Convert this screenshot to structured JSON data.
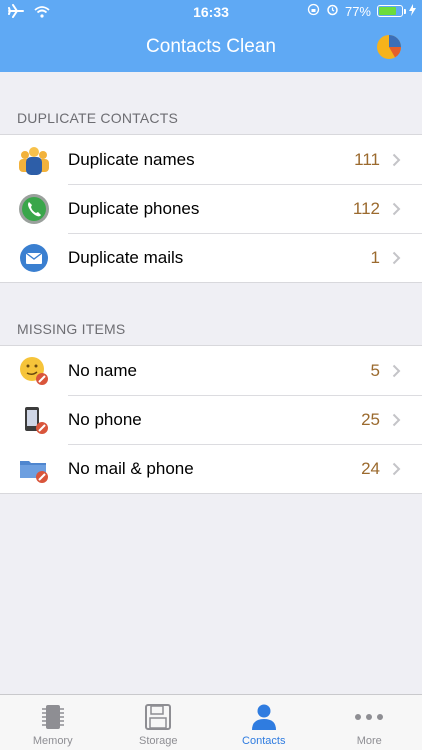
{
  "status": {
    "time": "16:33",
    "battery": "77%",
    "battery_level": 0.77
  },
  "nav": {
    "title": "Contacts Clean",
    "action_icon": "pie-chart-icon"
  },
  "sections": [
    {
      "header": "DUPLICATE CONTACTS",
      "rows": [
        {
          "label": "Duplicate names",
          "count": "111",
          "icon": "group-people-icon"
        },
        {
          "label": "Duplicate phones",
          "count": "112",
          "icon": "phone-icon"
        },
        {
          "label": "Duplicate mails",
          "count": "1",
          "icon": "mail-icon"
        }
      ]
    },
    {
      "header": "MISSING ITEMS",
      "rows": [
        {
          "label": "No name",
          "count": "5",
          "icon": "no-name-face-icon"
        },
        {
          "label": "No phone",
          "count": "25",
          "icon": "no-phone-icon"
        },
        {
          "label": "No mail & phone",
          "count": "24",
          "icon": "no-mail-folder-icon"
        }
      ]
    }
  ],
  "tabs": [
    {
      "label": "Memory",
      "icon": "chip-icon",
      "active": false
    },
    {
      "label": "Storage",
      "icon": "floppy-icon",
      "active": false
    },
    {
      "label": "Contacts",
      "icon": "person-icon",
      "active": true
    },
    {
      "label": "More",
      "icon": "more-dots-icon",
      "active": false
    }
  ],
  "colors": {
    "nav_bg": "#5fa9f4",
    "count_text": "#9b6a2e",
    "tab_active": "#2f7ce0",
    "tab_inactive": "#8e8e93"
  }
}
